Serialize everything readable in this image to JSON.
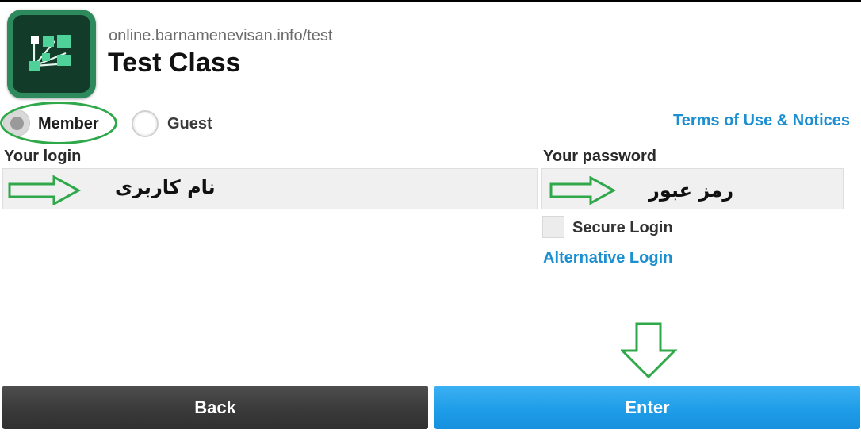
{
  "header": {
    "url": "online.barnamenevisan.info/test",
    "title": "Test Class",
    "app_icon": "adobe-connect-app-icon"
  },
  "login_type": {
    "options": [
      {
        "label": "Member",
        "selected": true
      },
      {
        "label": "Guest",
        "selected": false
      }
    ]
  },
  "links": {
    "terms": "Terms of Use & Notices",
    "alternative_login": "Alternative Login"
  },
  "login": {
    "label": "Your login",
    "value": "نام کاربری"
  },
  "password": {
    "label": "Your password",
    "value": "رمز عبور"
  },
  "secure_login": {
    "label": "Secure Login",
    "checked": false
  },
  "buttons": {
    "back": "Back",
    "enter": "Enter"
  },
  "annotations": {
    "color": "#2fa84a",
    "icons": [
      "arrow-right-icon",
      "arrow-right-icon",
      "arrow-down-icon",
      "highlight-ellipse"
    ]
  },
  "colors": {
    "link": "#1b8fd1",
    "enter_button": "#1f9de8",
    "back_button": "#3a3a3a",
    "icon_bg": "#123b29"
  }
}
